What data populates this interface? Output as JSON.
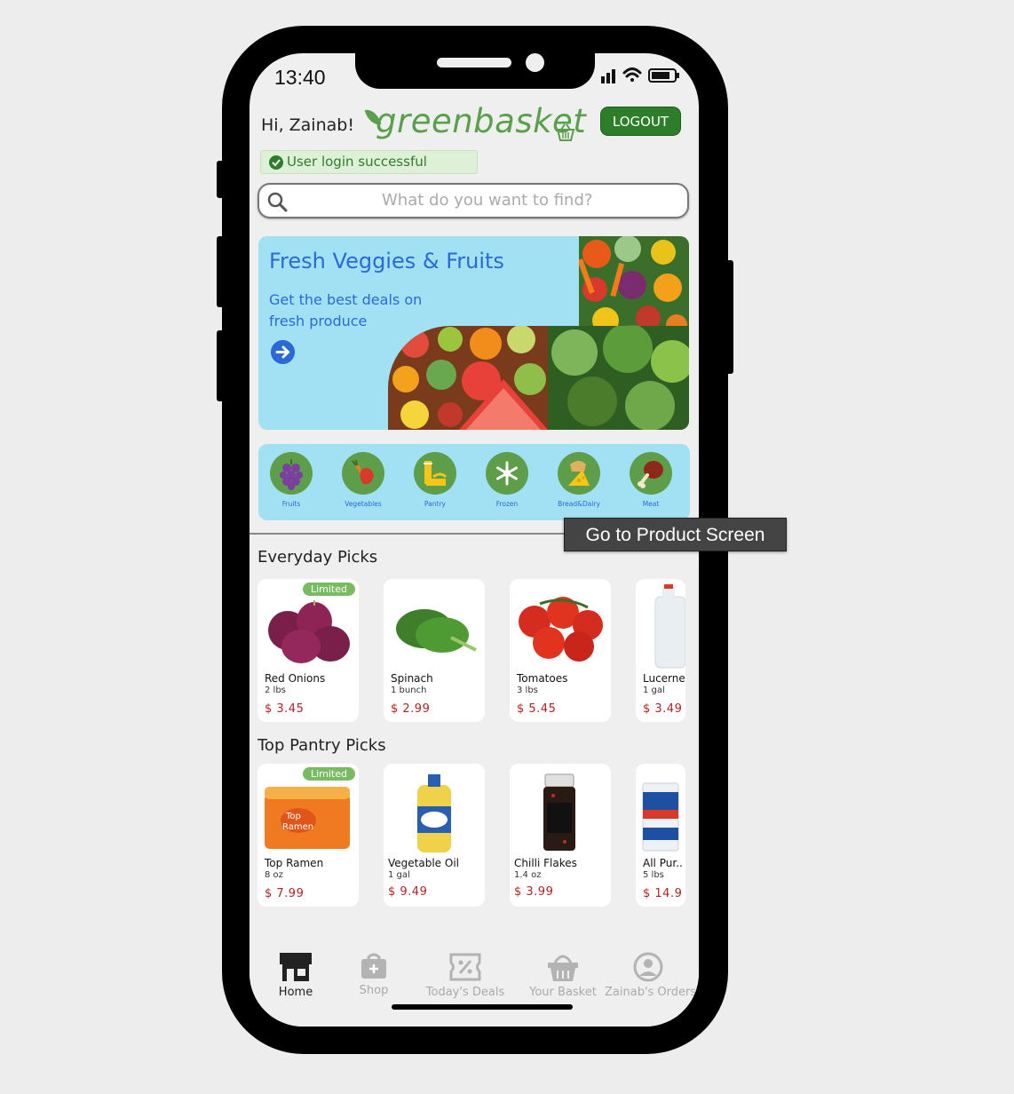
{
  "status_bar": {
    "time": "13:40"
  },
  "header": {
    "greeting": "Hi, Zainab!",
    "logo_text": "greenbasket",
    "logout_label": "LOGOUT",
    "toast": "User login successful"
  },
  "search": {
    "placeholder": "What do you want to find?"
  },
  "banner": {
    "title": "Fresh Veggies & Fruits",
    "subtitle": "Get the best deals on fresh produce"
  },
  "categories": [
    {
      "label": "Fruits",
      "icon": "grapes-icon"
    },
    {
      "label": "Vegetables",
      "icon": "carrot-pepper-icon"
    },
    {
      "label": "Pantry",
      "icon": "pantry-icon"
    },
    {
      "label": "Frozen",
      "icon": "snowflake-icon"
    },
    {
      "label": "Bread&Dairy",
      "icon": "cheese-bread-icon"
    },
    {
      "label": "Meat",
      "icon": "drumstick-icon"
    }
  ],
  "tooltip": "Go to Product Screen",
  "everyday": {
    "title": "Everyday Picks",
    "items": [
      {
        "name": "Red Onions",
        "qty": "2 lbs",
        "price": "$ 3.45",
        "badge": "Limited"
      },
      {
        "name": "Spinach",
        "qty": "1 bunch",
        "price": "$ 2.99"
      },
      {
        "name": "Tomatoes",
        "qty": "3 lbs",
        "price": "$ 5.45"
      },
      {
        "name": "Lucerne",
        "qty": "1 gal",
        "price": "$ 3.49"
      }
    ]
  },
  "pantry": {
    "title": "Top Pantry Picks",
    "items": [
      {
        "name": "Top Ramen",
        "qty": "8 oz",
        "price": "$ 7.99",
        "badge": "Limited"
      },
      {
        "name": "Vegetable Oil",
        "qty": "1 gal",
        "price": "$ 9.49"
      },
      {
        "name": "Chilli Flakes",
        "qty": "1.4 oz",
        "price": "$ 3.99"
      },
      {
        "name": "All Pur..",
        "qty": "5 lbs",
        "price": "$ 14.9"
      }
    ]
  },
  "tabs": [
    {
      "label": "Home",
      "icon": "store-icon",
      "active": true
    },
    {
      "label": "Shop",
      "icon": "shopping-bag-icon"
    },
    {
      "label": "Today's Deals",
      "icon": "percent-ticket-icon"
    },
    {
      "label": "Your Basket",
      "icon": "basket-icon"
    },
    {
      "label": "Zainab's Orders",
      "icon": "user-circle-icon"
    }
  ],
  "colors": {
    "brand_green": "#5aa04c",
    "dark_green": "#2e7d2a",
    "banner_blue": "#a2e0f4",
    "link_blue": "#2a6ad6",
    "price_red": "#b22222"
  }
}
